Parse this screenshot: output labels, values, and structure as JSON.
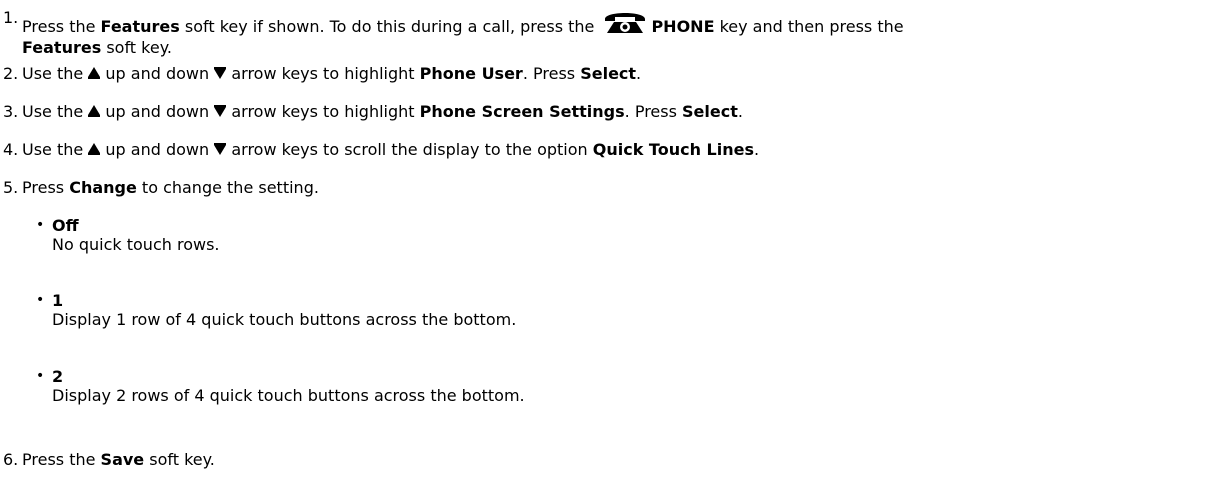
{
  "steps": [
    {
      "num": "1.",
      "segments": [
        {
          "t": "Press the "
        },
        {
          "b": "Features"
        },
        {
          "t": " soft key if shown. To do this during a call, press the "
        },
        {
          "icon": "phone-key-icon"
        },
        {
          "b": "PHONE"
        },
        {
          "t": " key and then press the "
        },
        {
          "br": true
        },
        {
          "b": "Features"
        },
        {
          "t": " soft key."
        }
      ]
    },
    {
      "num": "2.",
      "segments": [
        {
          "t": "Use the "
        },
        {
          "icon": "up-arrow-icon"
        },
        {
          "t": " up and down "
        },
        {
          "icon": "down-arrow-icon"
        },
        {
          "t": " arrow keys to highlight "
        },
        {
          "b": "Phone User"
        },
        {
          "t": ". Press "
        },
        {
          "b": "Select"
        },
        {
          "t": "."
        }
      ]
    },
    {
      "num": "3.",
      "segments": [
        {
          "t": "Use the "
        },
        {
          "icon": "up-arrow-icon"
        },
        {
          "t": " up and down "
        },
        {
          "icon": "down-arrow-icon"
        },
        {
          "t": " arrow keys to highlight "
        },
        {
          "b": "Phone Screen Settings"
        },
        {
          "t": ". Press "
        },
        {
          "b": "Select"
        },
        {
          "t": "."
        }
      ]
    },
    {
      "num": "4.",
      "segments": [
        {
          "t": "Use the "
        },
        {
          "icon": "up-arrow-icon"
        },
        {
          "t": " up and down "
        },
        {
          "icon": "down-arrow-icon"
        },
        {
          "t": " arrow keys to scroll the display to the option "
        },
        {
          "b": "Quick Touch Lines"
        },
        {
          "t": "."
        }
      ]
    },
    {
      "num": "5.",
      "segments": [
        {
          "t": "Press "
        },
        {
          "b": "Change"
        },
        {
          "t": " to change the setting."
        }
      ]
    },
    {
      "num": "6.",
      "segments": [
        {
          "t": "Press the "
        },
        {
          "b": "Save"
        },
        {
          "t": " soft key."
        }
      ]
    }
  ],
  "options": [
    {
      "title": "Off",
      "desc": "No quick touch rows."
    },
    {
      "title": "1",
      "desc": "Display 1 row of 4 quick touch buttons across the bottom."
    },
    {
      "title": "2",
      "desc": "Display 2 rows of 4 quick touch buttons across the bottom."
    }
  ],
  "bullet_glyph": "•",
  "colors": {
    "text": "#000000",
    "background": "#ffffff"
  }
}
